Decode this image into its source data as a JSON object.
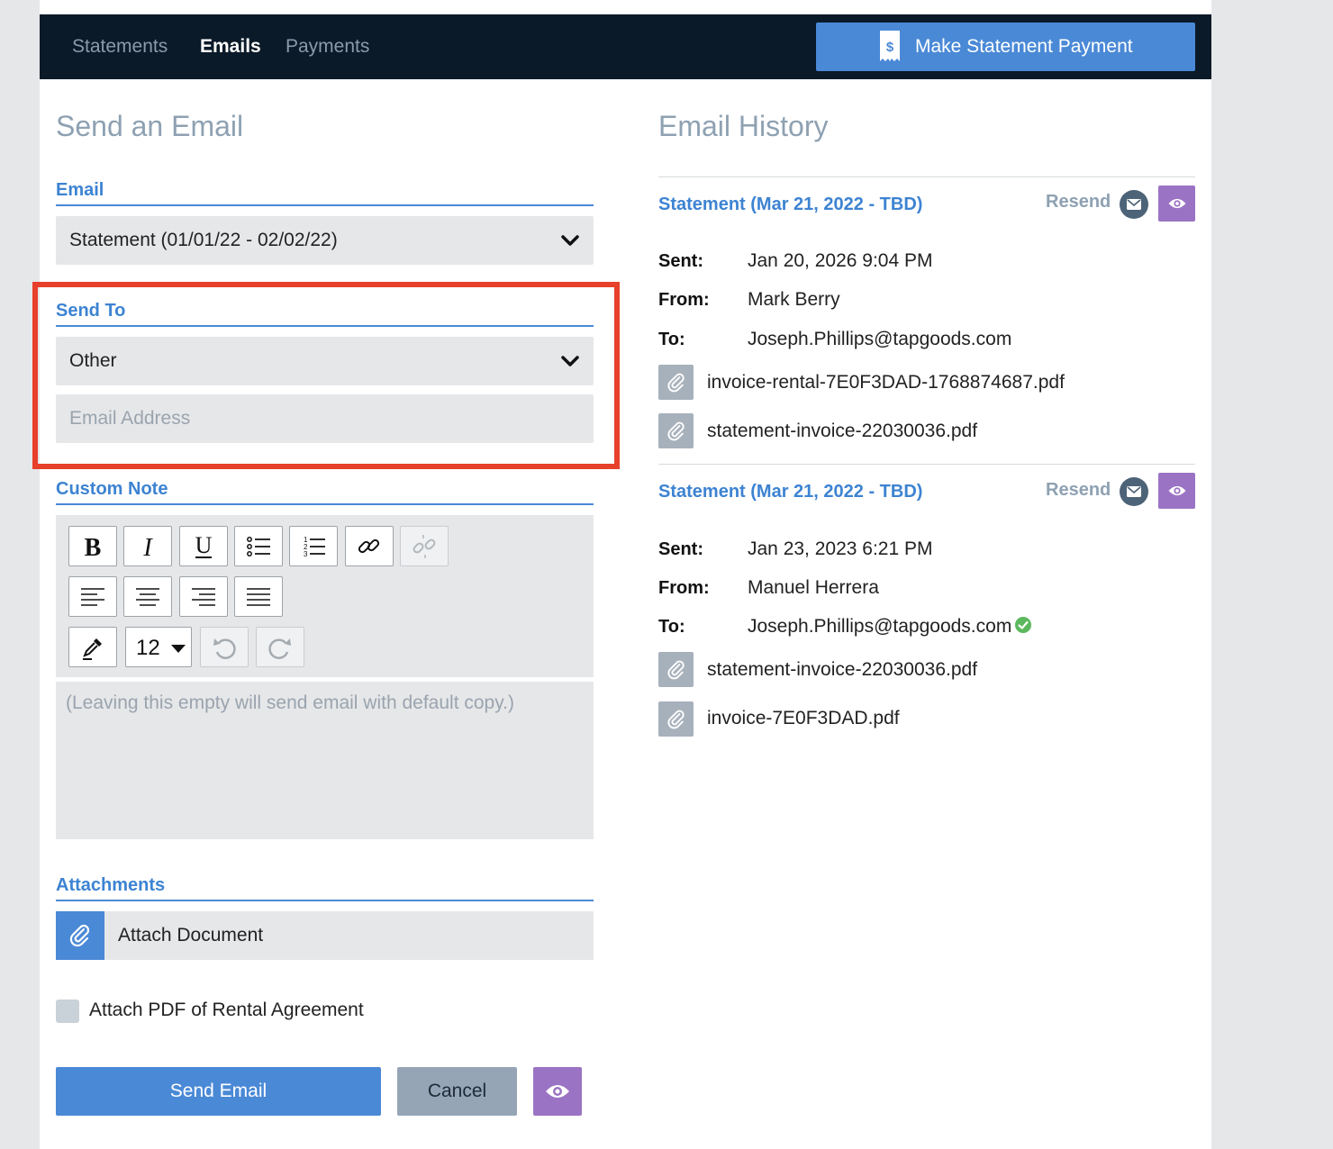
{
  "nav": {
    "tabs": [
      {
        "label": "Statements"
      },
      {
        "label": "Emails"
      },
      {
        "label": "Payments"
      }
    ],
    "pay_button": "Make Statement Payment"
  },
  "send": {
    "title": "Send an Email",
    "email_label": "Email",
    "email_value": "Statement (01/01/22 - 02/02/22)",
    "send_to_label": "Send To",
    "send_to_value": "Other",
    "email_placeholder": "Email Address",
    "custom_note_label": "Custom Note",
    "font_size": "12",
    "note_placeholder": "(Leaving this empty will send email with default copy.)",
    "attachments_label": "Attachments",
    "attach_document": "Attach Document",
    "attach_pdf_label": "Attach PDF of Rental Agreement",
    "send_button": "Send Email",
    "cancel_button": "Cancel"
  },
  "history": {
    "title": "Email History",
    "resend_label": "Resend",
    "labels": {
      "sent": "Sent:",
      "from": "From:",
      "to": "To:"
    },
    "entries": [
      {
        "title": "Statement (Mar 21, 2022 - TBD)",
        "sent": "Jan 20, 2026  9:04 PM",
        "from": "Mark Berry",
        "to": "Joseph.Phillips@tapgoods.com",
        "files": [
          "invoice-rental-7E0F3DAD-1768874687.pdf",
          "statement-invoice-22030036.pdf"
        ]
      },
      {
        "title": "Statement (Mar 21, 2022 - TBD)",
        "sent": "Jan 23, 2023  6:21 PM",
        "from": "Manuel Herrera",
        "to": "Joseph.Phillips@tapgoods.com",
        "files": [
          "statement-invoice-22030036.pdf",
          "invoice-7E0F3DAD.pdf"
        ]
      }
    ]
  },
  "colors": {
    "nav_bg": "#0b1a28",
    "accent_blue": "#4a89d6",
    "preview_purple": "#9b73c4",
    "highlight_red": "#e7402b",
    "delivered_green": "#5cb85c"
  }
}
